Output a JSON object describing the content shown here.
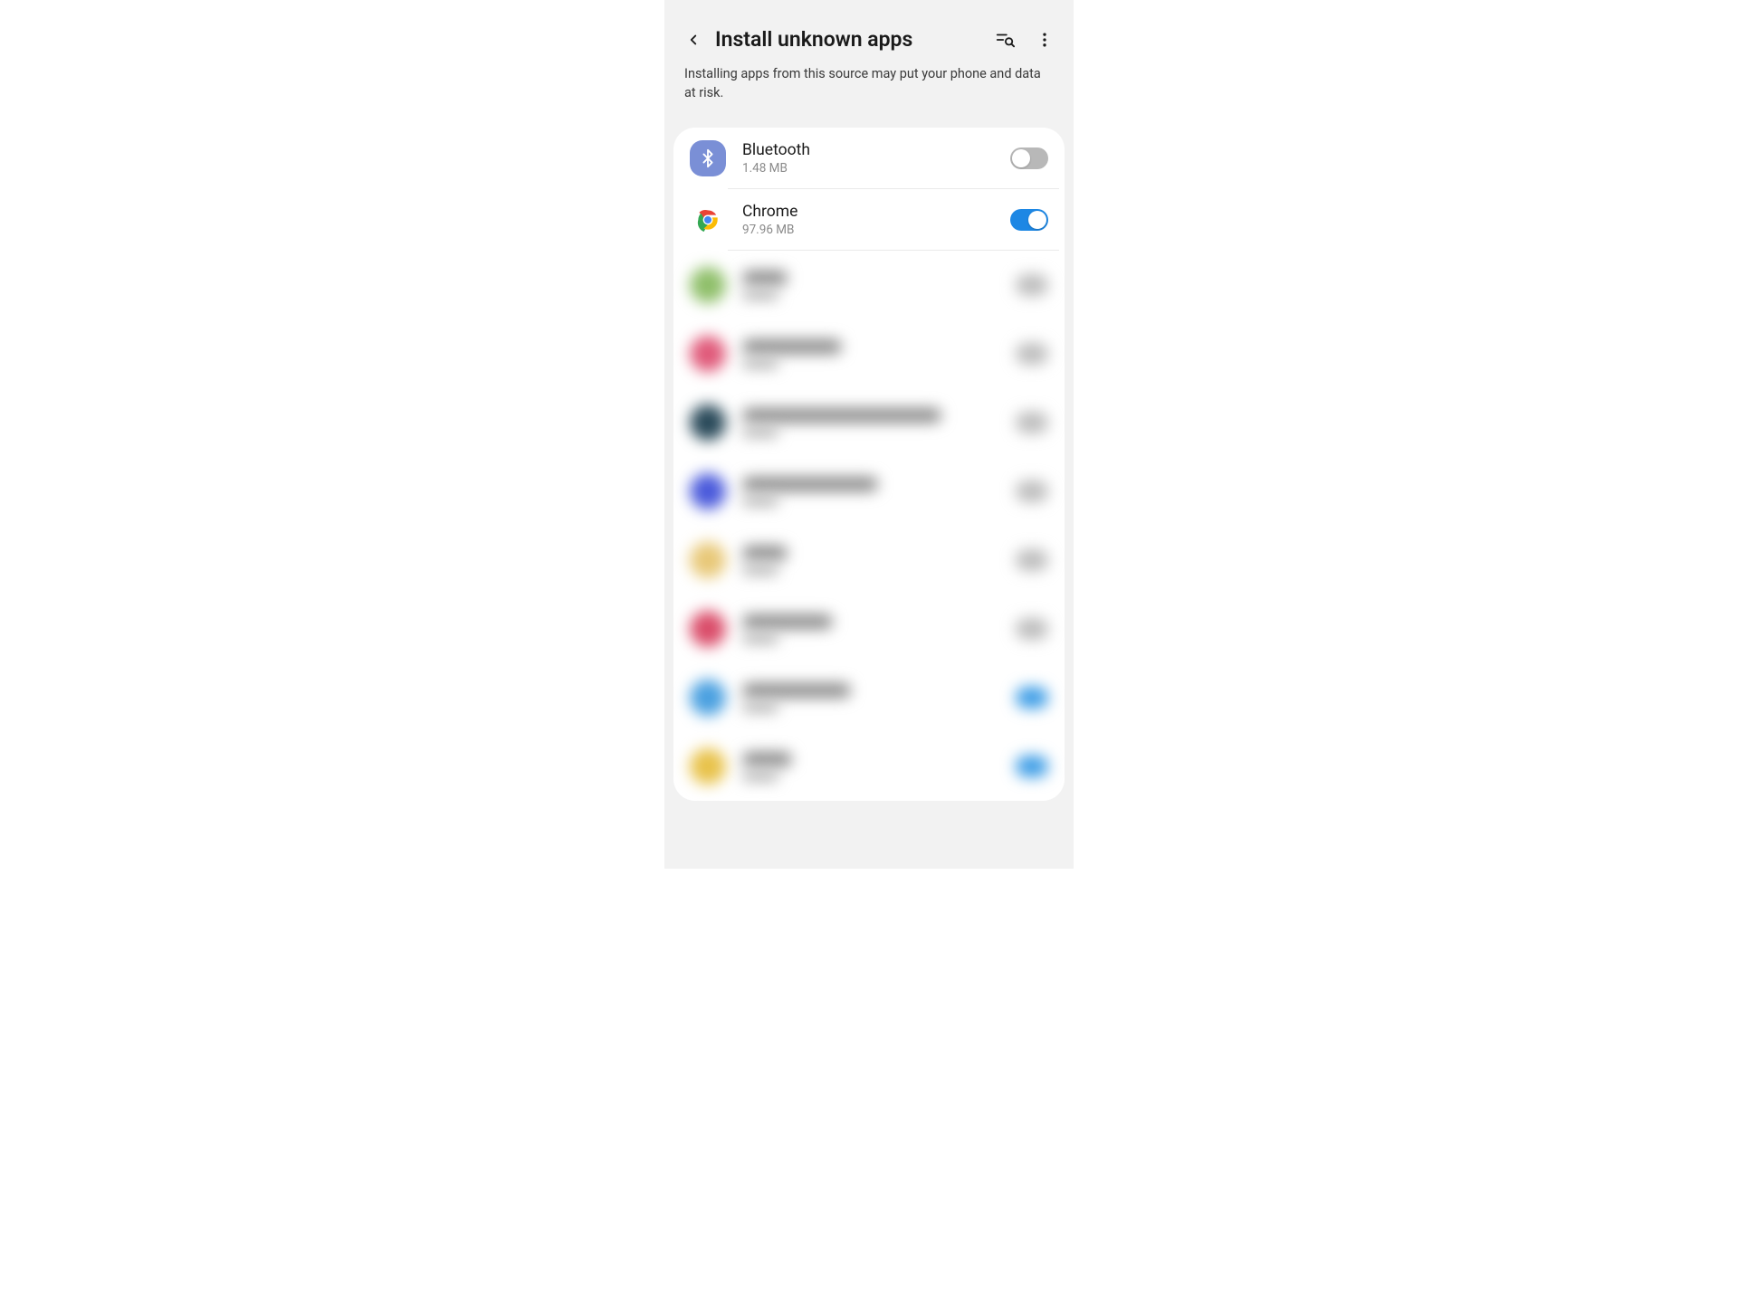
{
  "header": {
    "title": "Install unknown apps",
    "subtitle": "Installing apps from this source may put your phone and data at risk."
  },
  "apps": [
    {
      "name": "Bluetooth",
      "size": "1.48 MB",
      "enabled": false,
      "icon": "bluetooth"
    },
    {
      "name": "Chrome",
      "size": "97.96 MB",
      "enabled": true,
      "icon": "chrome"
    }
  ],
  "blurred_rows": [
    {
      "icon_color": "#8fbf6a",
      "line_width": 50,
      "toggle_color": "#bdbdbd"
    },
    {
      "icon_color": "#e05a7a",
      "line_width": 110,
      "toggle_color": "#bdbdbd"
    },
    {
      "icon_color": "#2a4a5a",
      "line_width": 220,
      "toggle_color": "#bdbdbd"
    },
    {
      "icon_color": "#4a5adb",
      "line_width": 150,
      "toggle_color": "#bdbdbd"
    },
    {
      "icon_color": "#e8c878",
      "line_width": 50,
      "toggle_color": "#bdbdbd"
    },
    {
      "icon_color": "#da4d6a",
      "line_width": 100,
      "toggle_color": "#bdbdbd"
    },
    {
      "icon_color": "#4aa0e0",
      "line_width": 120,
      "toggle_color": "#3d9de6"
    },
    {
      "icon_color": "#e8c24a",
      "line_width": 55,
      "toggle_color": "#3d9de6"
    }
  ]
}
